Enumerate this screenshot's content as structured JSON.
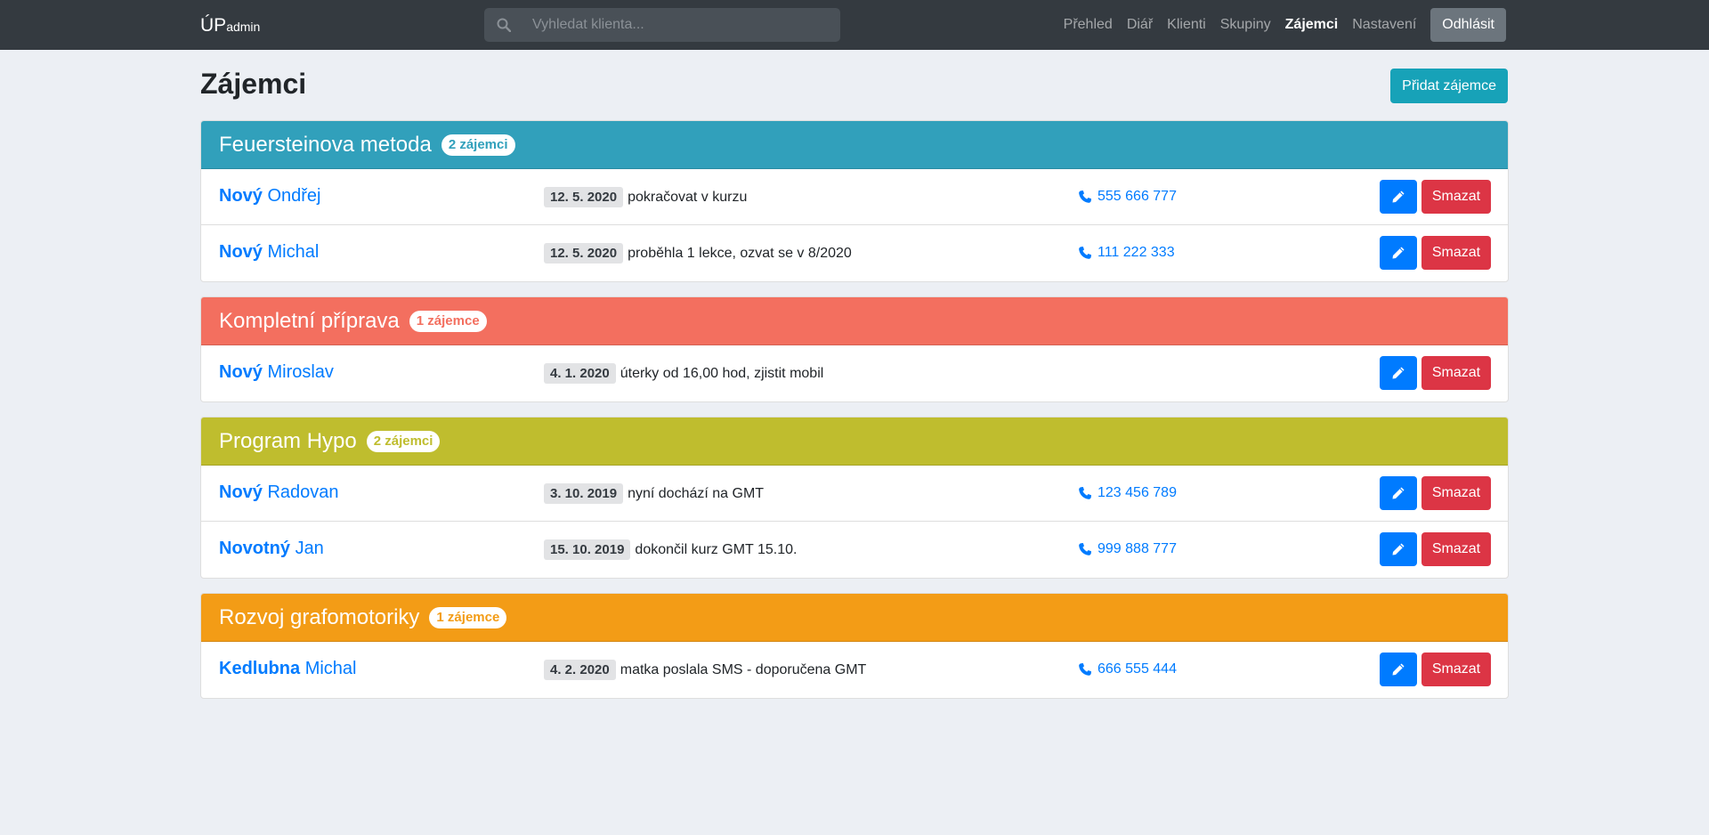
{
  "nav": {
    "brand_main": "ÚP",
    "brand_sub": "admin",
    "search_placeholder": "Vyhledat klienta...",
    "links": [
      {
        "label": "Přehled",
        "active": false
      },
      {
        "label": "Diář",
        "active": false
      },
      {
        "label": "Klienti",
        "active": false
      },
      {
        "label": "Skupiny",
        "active": false
      },
      {
        "label": "Zájemci",
        "active": true
      },
      {
        "label": "Nastavení",
        "active": false
      }
    ],
    "logout_label": "Odhlásit"
  },
  "page": {
    "title": "Zájemci",
    "add_button_label": "Přidat zájemce"
  },
  "actions": {
    "delete_label": "Smazat"
  },
  "groups": [
    {
      "name": "Feuersteinova metoda",
      "badge": "2 zájemci",
      "color": "#31a0bb",
      "items": [
        {
          "surname": "Nový",
          "firstname": "Ondřej",
          "date": "12. 5. 2020",
          "note": "pokračovat v kurzu",
          "phone": "555 666 777"
        },
        {
          "surname": "Nový",
          "firstname": "Michal",
          "date": "12. 5. 2020",
          "note": "proběhla 1 lekce, ozvat se v 8/2020",
          "phone": "111 222 333"
        }
      ]
    },
    {
      "name": "Kompletní příprava",
      "badge": "1 zájemce",
      "color": "#f36f5f",
      "items": [
        {
          "surname": "Nový",
          "firstname": "Miroslav",
          "date": "4. 1. 2020",
          "note": "úterky od 16,00 hod, zjistit mobil",
          "phone": ""
        }
      ]
    },
    {
      "name": "Program Hypo",
      "badge": "2 zájemci",
      "color": "#bfbd2e",
      "items": [
        {
          "surname": "Nový",
          "firstname": "Radovan",
          "date": "3. 10. 2019",
          "note": "nyní dochází na GMT",
          "phone": "123 456 789"
        },
        {
          "surname": "Novotný",
          "firstname": "Jan",
          "date": "15. 10. 2019",
          "note": "dokončil kurz GMT 15.10.",
          "phone": "999 888 777"
        }
      ]
    },
    {
      "name": "Rozvoj grafomotoriky",
      "badge": "1 zájemce",
      "color": "#f39c16",
      "items": [
        {
          "surname": "Kedlubna",
          "firstname": "Michal",
          "date": "4. 2. 2020",
          "note": "matka poslala SMS - doporučena GMT",
          "phone": "666 555 444"
        }
      ]
    }
  ]
}
